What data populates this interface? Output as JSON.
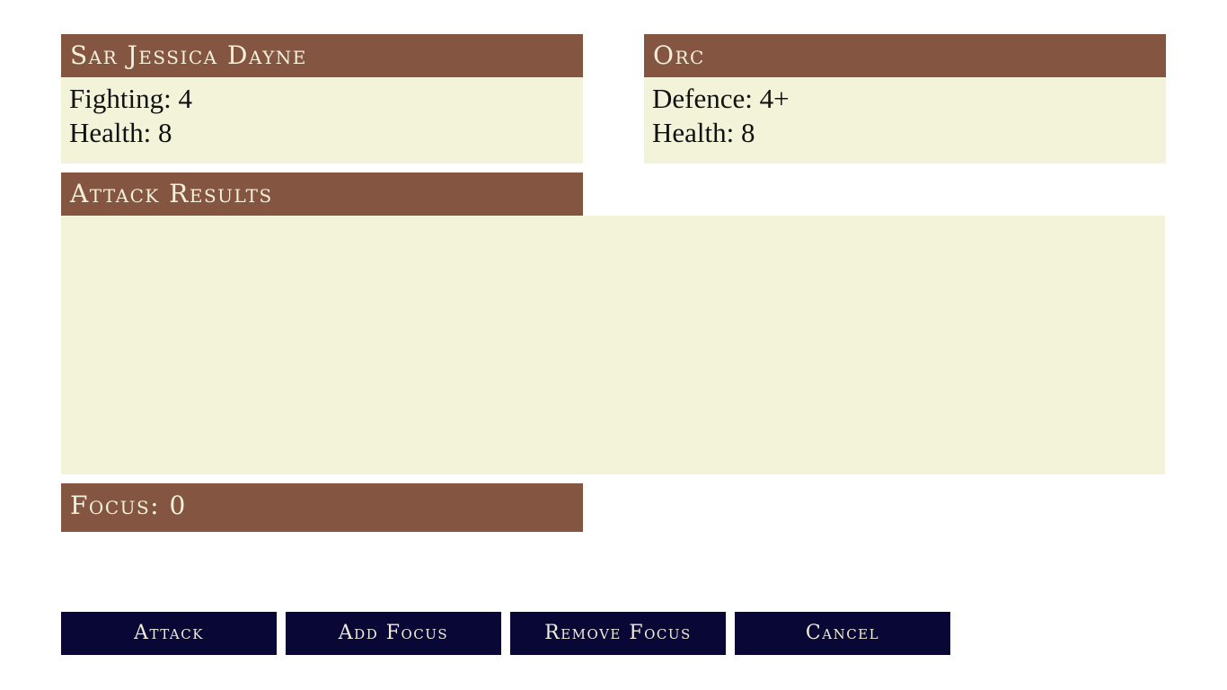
{
  "hero": {
    "name": "Sar Jessica Dayne",
    "stats": [
      {
        "label": "Fighting",
        "value": "4"
      },
      {
        "label": "Health",
        "value": "8"
      }
    ],
    "lines": [
      "Fighting: 4",
      "Health: 8"
    ]
  },
  "enemy": {
    "name": "Orc",
    "lines": [
      "Defence: 4+",
      "Health: 8"
    ]
  },
  "attack_results": {
    "title": "Attack Results"
  },
  "focus": {
    "text": "Focus: 0",
    "value": 0
  },
  "actions": {
    "attack_label": "Attack",
    "add_focus_label": "Add Focus",
    "remove_focus_label": "Remove Focus",
    "cancel_label": "Cancel"
  },
  "colors": {
    "header_bg": "#845641",
    "panel_bg": "#f3f3d9",
    "button_bg": "#080736"
  }
}
